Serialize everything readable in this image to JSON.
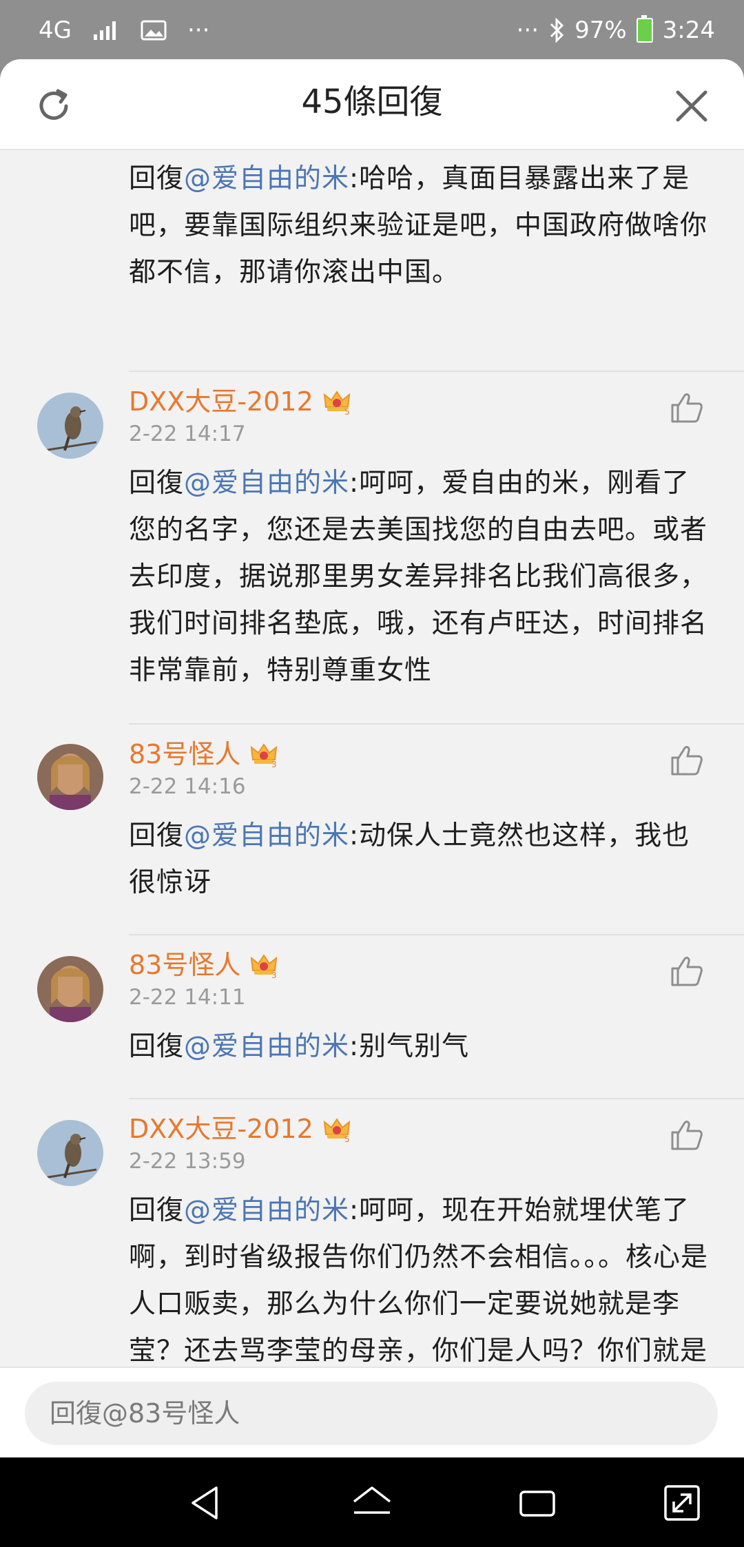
{
  "status_bar": {
    "network": "4G",
    "more_left": "···",
    "more_right": "···",
    "battery": "97%",
    "time": "3:24"
  },
  "header": {
    "title": "45條回復",
    "refresh_icon": "refresh-icon",
    "close_icon": "close-icon"
  },
  "comments": [
    {
      "user": "",
      "time": "",
      "reply_prefix": "回復",
      "mention": "@爱自由的米",
      "text": ":哈哈，真面目暴露出来了是吧，要靠国际组织来验证是吧，中国政府做啥你都不信，那请你滚出中国。"
    },
    {
      "user": "DXX大豆-2012",
      "time": "2-22 14:17",
      "reply_prefix": "回復",
      "mention": "@爱自由的米",
      "text": ":呵呵，爱自由的米，刚看了您的名字，您还是去美国找您的自由去吧。或者去印度，据说那里男女差异排名比我们高很多，我们时间排名垫底，哦，还有卢旺达，时间排名非常靠前，特别尊重女性"
    },
    {
      "user": "83号怪人",
      "time": "2-22 14:16",
      "reply_prefix": "回復",
      "mention": "@爱自由的米",
      "text": ":动保人士竟然也这样，我也很惊讶"
    },
    {
      "user": "83号怪人",
      "time": "2-22 14:11",
      "reply_prefix": "回復",
      "mention": "@爱自由的米",
      "text": ":别气别气"
    },
    {
      "user": "DXX大豆-2012",
      "time": "2-22 13:59",
      "reply_prefix": "回復",
      "mention": "@爱自由的米",
      "text": ":呵呵，现在开始就埋伏笔了啊，到时省级报告你们仍然不会相信。。。核心是人口贩卖，那么为什么你们一定要说她就是李莹？还去骂李莹的母亲，你们是人吗？你们就是一群网络极端分子"
    }
  ],
  "reply_bar": {
    "placeholder": "回復@83号怪人"
  },
  "colors": {
    "username": "#e8782c",
    "mention": "#4b76b4",
    "timestamp": "#9a9a9a",
    "background": "#f2f2f2"
  }
}
